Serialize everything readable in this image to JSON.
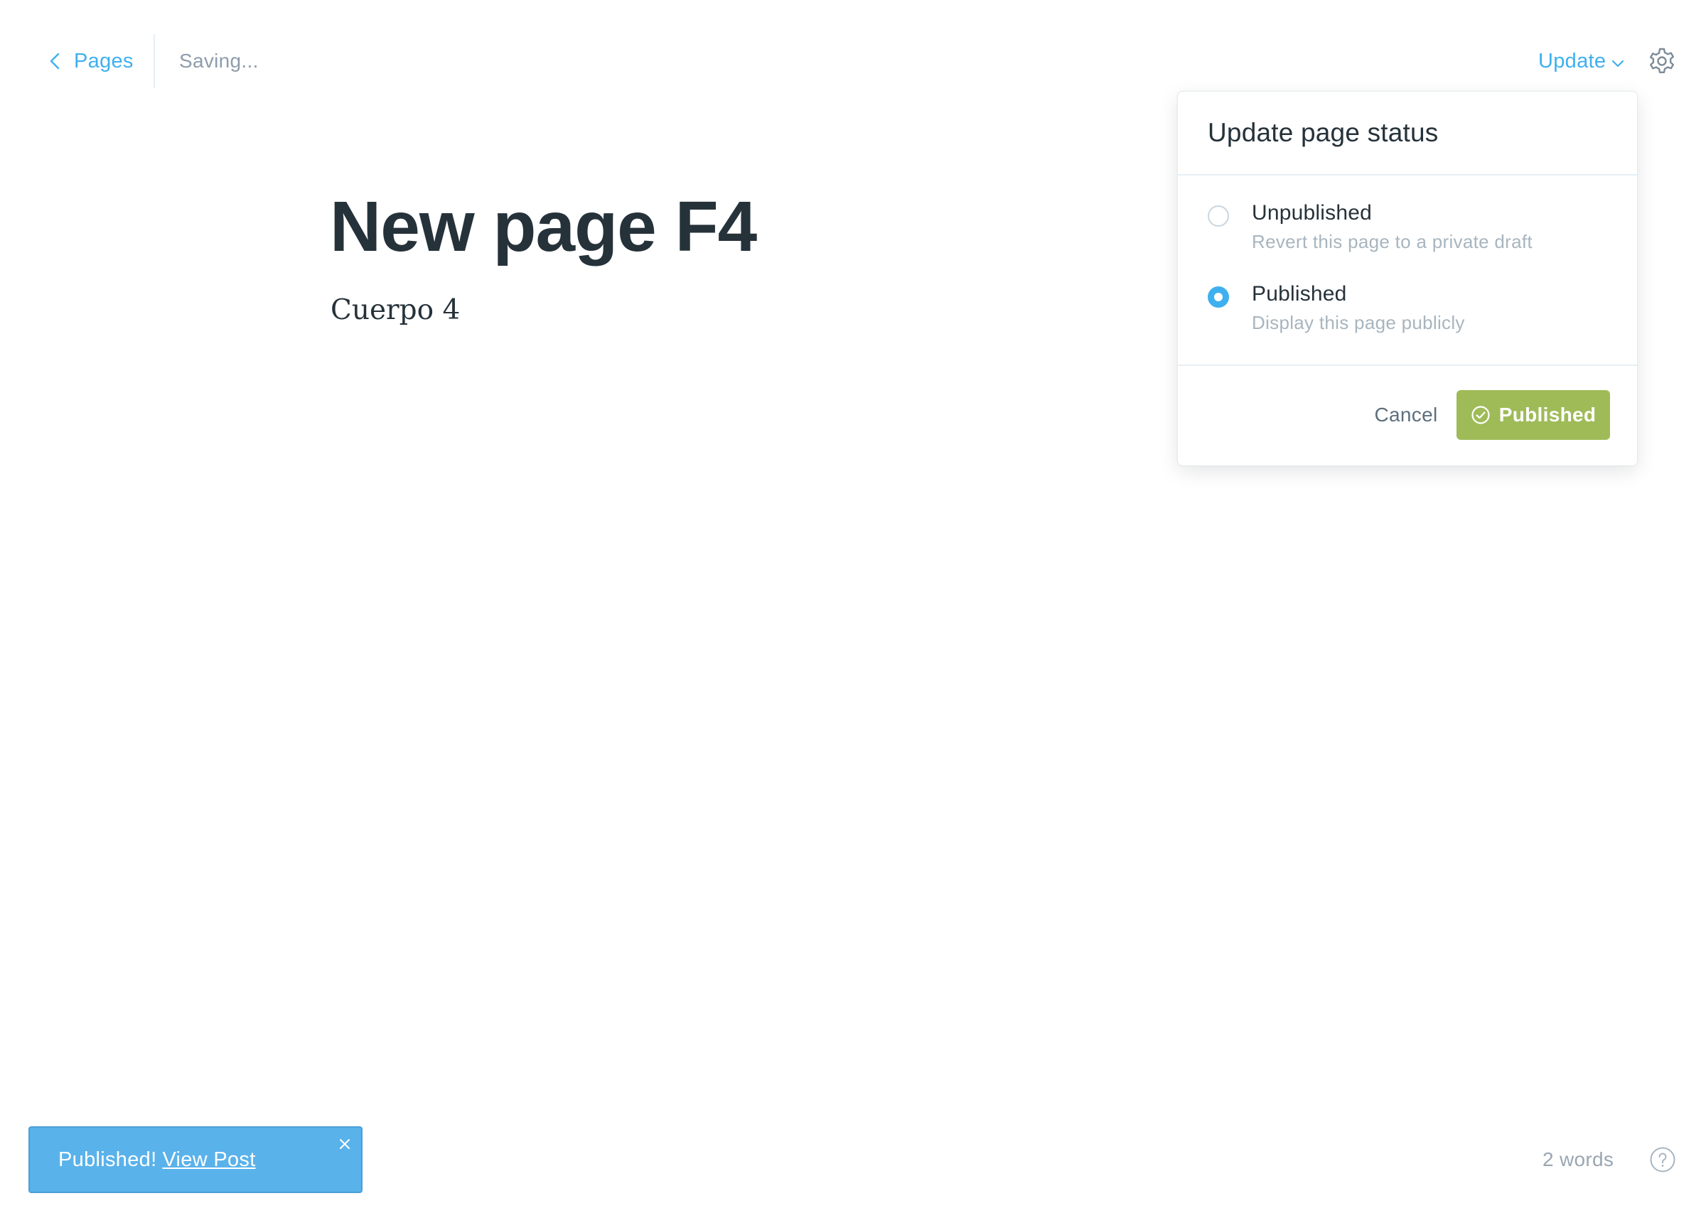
{
  "header": {
    "back_label": "Pages",
    "status_text": "Saving...",
    "update_label": "Update",
    "icons": {
      "back": "chevron-left-icon",
      "update_caret": "chevron-down-icon",
      "settings": "gear-icon"
    }
  },
  "editor": {
    "title": "New page F4",
    "body": "Cuerpo 4"
  },
  "status_panel": {
    "title": "Update page status",
    "options": [
      {
        "label": "Unpublished",
        "description": "Revert this page to a private draft",
        "selected": false
      },
      {
        "label": "Published",
        "description": "Display this page publicly",
        "selected": true
      }
    ],
    "cancel_label": "Cancel",
    "confirm_label": "Published",
    "confirm_icon": "check-circle-icon"
  },
  "notification": {
    "message": "Published!",
    "link_label": "View Post",
    "close_icon": "close-icon"
  },
  "footer": {
    "word_count": "2 words",
    "help_icon": "help-icon"
  },
  "colors": {
    "accent": "#3eb0ef",
    "success": "#9fbb58",
    "notification_bg": "#5ab2ea",
    "text_dark": "#26323a",
    "text_muted": "#a8b5bf"
  }
}
